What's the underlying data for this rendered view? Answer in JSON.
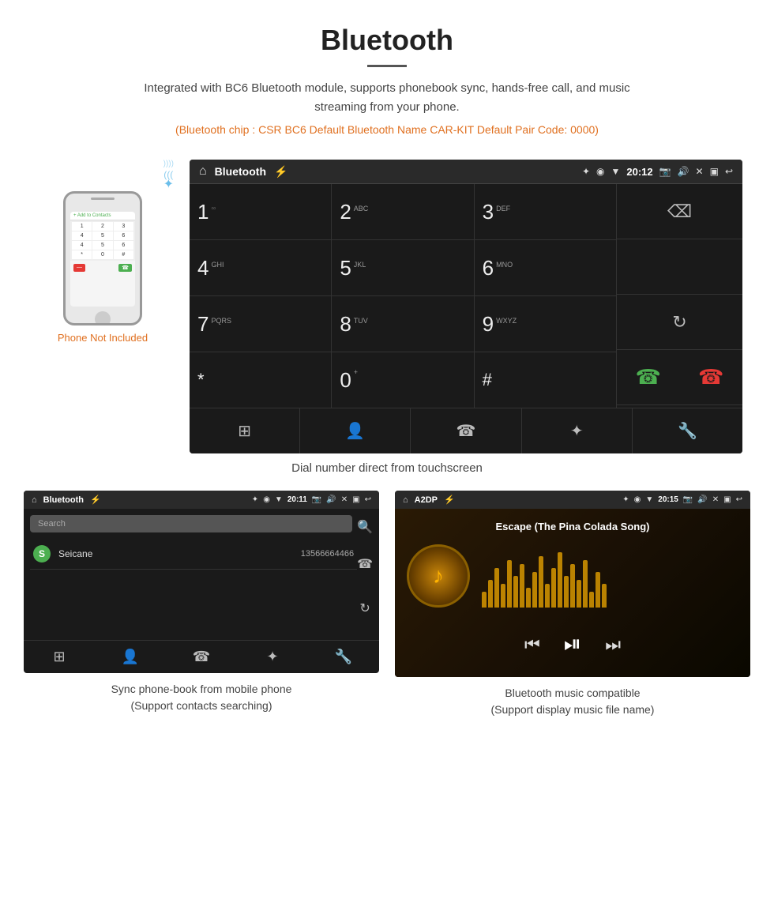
{
  "page": {
    "title": "Bluetooth",
    "subtitle": "Integrated with BC6 Bluetooth module, supports phonebook sync, hands-free call, and music streaming from your phone.",
    "specs": "(Bluetooth chip : CSR BC6    Default Bluetooth Name CAR-KIT    Default Pair Code: 0000)"
  },
  "phone_not_included": "Phone Not Included",
  "dial_screen": {
    "title": "Bluetooth",
    "time": "20:12",
    "keys": [
      {
        "main": "1",
        "sub": ""
      },
      {
        "main": "2",
        "sub": "ABC"
      },
      {
        "main": "3",
        "sub": "DEF"
      },
      {
        "main": "4",
        "sub": "GHI"
      },
      {
        "main": "5",
        "sub": "JKL"
      },
      {
        "main": "6",
        "sub": "MNO"
      },
      {
        "main": "7",
        "sub": "PQRS"
      },
      {
        "main": "8",
        "sub": "TUV"
      },
      {
        "main": "9",
        "sub": "WXYZ"
      },
      {
        "main": "*",
        "sub": ""
      },
      {
        "main": "0",
        "sub": "+"
      },
      {
        "main": "#",
        "sub": ""
      }
    ],
    "caption": "Dial number direct from touchscreen"
  },
  "phonebook_screen": {
    "title": "Bluetooth",
    "time": "20:11",
    "search_placeholder": "Search",
    "contact": {
      "letter": "S",
      "name": "Seicane",
      "number": "13566664466"
    },
    "caption_line1": "Sync phone-book from mobile phone",
    "caption_line2": "(Support contacts searching)"
  },
  "music_screen": {
    "title": "A2DP",
    "time": "20:15",
    "song_title": "Escape (The Pina Colada Song)",
    "caption_line1": "Bluetooth music compatible",
    "caption_line2": "(Support display music file name)"
  },
  "icons": {
    "home": "⌂",
    "usb": "⚡",
    "bluetooth": "✦",
    "location": "◉",
    "wifi": "▲",
    "camera": "📷",
    "volume": "🔊",
    "close": "✕",
    "screen": "▣",
    "back": "↩",
    "backspace": "⌫",
    "refresh": "↻",
    "call_green": "📞",
    "call_red": "📵",
    "grid": "⊞",
    "contacts": "👤",
    "phone": "☎",
    "bt": "⚡",
    "wrench": "🔧",
    "search": "🔍",
    "prev": "⏮",
    "play_pause": "⏯",
    "next": "⏭",
    "music_note": "♪"
  }
}
